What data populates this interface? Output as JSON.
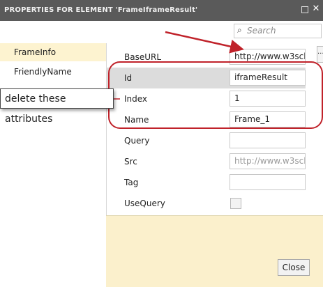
{
  "window": {
    "title": "PROPERTIES FOR ELEMENT 'FrameIframeResult'"
  },
  "search": {
    "placeholder": "Search"
  },
  "sidebar": {
    "items": [
      {
        "label": "FrameInfo",
        "selected": true
      },
      {
        "label": "FriendlyName",
        "selected": false
      }
    ]
  },
  "properties": [
    {
      "label": "BaseURL",
      "value": "http://www.w3scl"
    },
    {
      "label": "Id",
      "value": "iframeResult"
    },
    {
      "label": "Index",
      "value": "1"
    },
    {
      "label": "Name",
      "value": "Frame_1"
    },
    {
      "label": "Query",
      "value": ""
    },
    {
      "label": "Src",
      "value": "http://www.w3scl"
    },
    {
      "label": "Tag",
      "value": ""
    },
    {
      "label": "UseQuery",
      "checked": false
    }
  ],
  "basis_button": "...",
  "footer": {
    "close_label": "Close"
  },
  "annotation": {
    "callout_text": "delete these attributes",
    "highlight_color": "#c0222a",
    "arrow_color": "#c0222a"
  },
  "colors": {
    "titlebar": "#5a5a5a",
    "selected_nav": "#fdf3d0",
    "selected_row": "#dcdcdc",
    "description_bg": "#fbf0cc"
  }
}
